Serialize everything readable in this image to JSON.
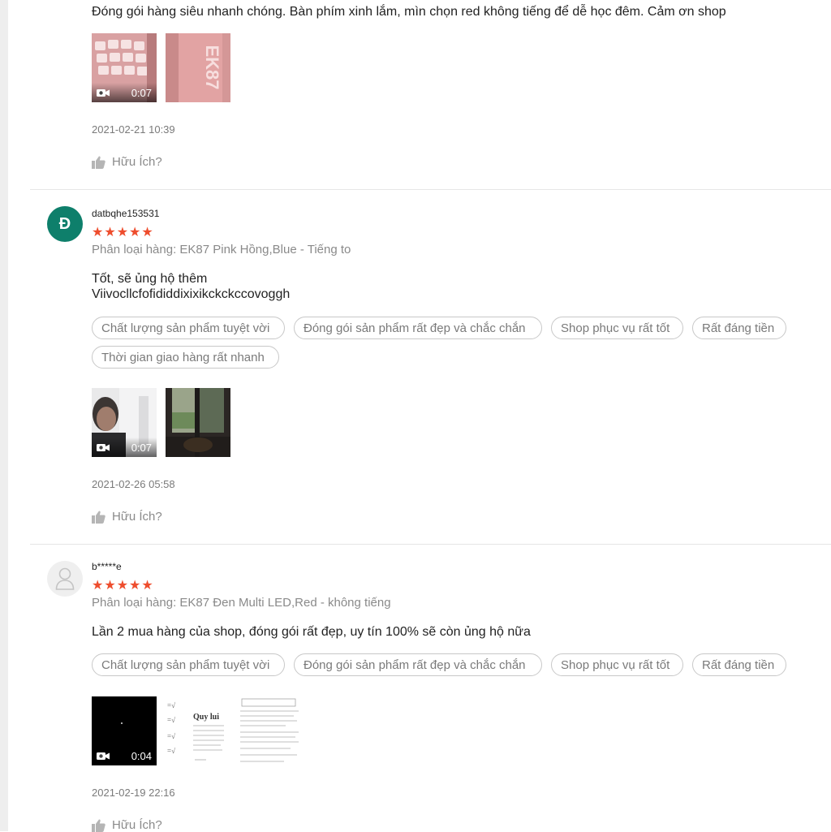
{
  "reviews": [
    {
      "comment": [
        "Đóng gói hàng siêu nhanh chóng. Bàn phím xinh lắm, mìn chọn red không tiếng để dễ học đêm. Cảm ơn shop"
      ],
      "media": [
        {
          "type": "video",
          "duration": "0:07",
          "content": "pink keyboard keys"
        },
        {
          "type": "image",
          "content": "EK87 box",
          "text": "EK87"
        }
      ],
      "timestamp": "2021-02-21 10:39",
      "helpful_label": "Hữu Ích?"
    },
    {
      "avatar_letter": "Đ",
      "username": "datbqhe153531",
      "rating": 5,
      "variant": "Phân loại hàng: EK87 Pink Hồng,Blue - Tiếng to",
      "comment": [
        "Tốt, sẽ ủng hộ thêm",
        "Viivocllcfofididdixixikckckccovoggh"
      ],
      "tags": [
        "Chất lượng sản phẩm tuyệt vời",
        "Đóng gói sản phẩm rất đẹp và chắc chắn",
        "Shop phục vụ rất tốt",
        "Rất đáng tiền",
        "Thời gian giao hàng rất nhanh"
      ],
      "media": [
        {
          "type": "video",
          "duration": "0:07",
          "content": "man in room"
        },
        {
          "type": "image",
          "content": "window view"
        }
      ],
      "timestamp": "2021-02-26 05:58",
      "helpful_label": "Hữu Ích?"
    },
    {
      "avatar": "user-placeholder-icon",
      "username": "b*****e",
      "rating": 5,
      "variant": "Phân loại hàng: EK87 Đen Multi LED,Red - không tiếng",
      "comment": [
        "Lần 2 mua hàng của shop, đóng gói rất đẹp, uy tín 100% sẽ còn ủng hộ nữa"
      ],
      "tags": [
        "Chất lượng sản phẩm tuyệt vời",
        "Đóng gói sản phẩm rất đẹp và chắc chắn",
        "Shop phục vụ rất tốt",
        "Rất đáng tiền"
      ],
      "media": [
        {
          "type": "video",
          "duration": "0:04",
          "content": "black video"
        },
        {
          "type": "image",
          "content": "math notes",
          "text": "Quy lui"
        },
        {
          "type": "image",
          "content": "math worksheet"
        }
      ],
      "timestamp": "2021-02-19 22:16",
      "helpful_label": "Hữu Ích?"
    }
  ],
  "colors": {
    "star": "#ee4d2d",
    "avatar_bg": "#0e7f6b",
    "divider": "#e6e6e6"
  },
  "icons": {
    "helpful": "thumbs-up-icon",
    "video": "video-camera-icon",
    "avatar": "user-placeholder-icon"
  }
}
